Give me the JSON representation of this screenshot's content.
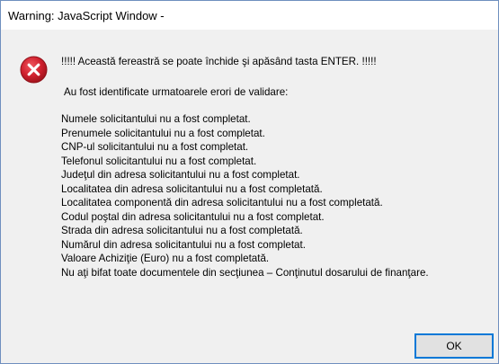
{
  "window": {
    "title": "Warning: JavaScript Window -"
  },
  "icon": {
    "name": "error-icon",
    "color": "#d0202e"
  },
  "message": {
    "headline": "!!!!! Această fereastră se poate închide şi apăsând tasta ENTER. !!!!!",
    "intro": "Au fost identificate urmatoarele erori de validare:",
    "errors": [
      "Numele solicitantului nu a fost completat.",
      "Prenumele solicitantului nu a fost completat.",
      "CNP-ul solicitantului nu a fost completat.",
      "Telefonul solicitantului nu a fost completat.",
      "Judeţul din adresa solicitantului nu a fost completat.",
      "Localitatea din adresa solicitantului nu a fost completată.",
      "Localitatea componentă din adresa solicitantului nu a fost completată.",
      "Codul poştal din adresa solicitantului nu a fost completat.",
      "Strada din adresa solicitantului nu a fost completată.",
      "Numărul din adresa solicitantului nu a fost completat.",
      "Valoare Achiziţie (Euro) nu a fost completată.",
      "Nu aţi bifat toate documentele din secţiunea – Conţinutul dosarului de finanţare."
    ]
  },
  "buttons": {
    "ok_label": "OK"
  }
}
